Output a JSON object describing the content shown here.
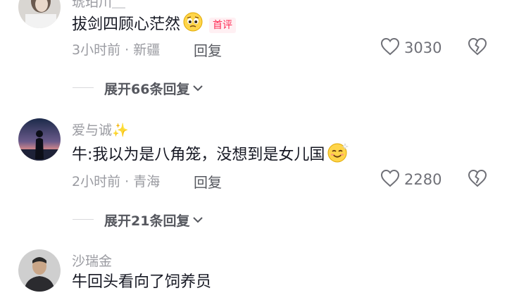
{
  "comments": [
    {
      "username": "琥珀川＿",
      "content": "拔剑四顾心茫然",
      "tag": "首评",
      "time": "3小时前",
      "location": "新疆",
      "reply_label": "回复",
      "likes": "3030",
      "expand_label": "展开66条回复",
      "emoji_icon": "worried-face-emoji"
    },
    {
      "username": "爱与诚✨",
      "content": "牛:我以为是八角笼，没想到是女儿国",
      "time": "2小时前",
      "location": "青海",
      "reply_label": "回复",
      "likes": "2280",
      "expand_label": "展开21条回复",
      "emoji_icon": "smiling-face-emoji"
    },
    {
      "username": "沙瑞金",
      "content": "牛回头看向了饲养员"
    }
  ],
  "meta_separator": " · ",
  "colors": {
    "accent": "#fe2c55",
    "secondary_text": "#9a9ba1"
  }
}
